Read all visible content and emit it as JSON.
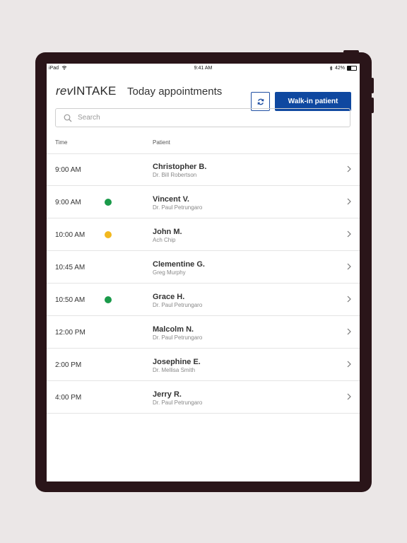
{
  "status_bar": {
    "device": "iPad",
    "time": "9:41 AM",
    "battery": "42%"
  },
  "header": {
    "logo_rev": "rev",
    "logo_intake": "INTAKE",
    "title": "Today appointments",
    "walkin_label": "Walk-in patient"
  },
  "search": {
    "placeholder": "Search"
  },
  "table": {
    "col_time": "Time",
    "col_patient": "Patient",
    "rows": [
      {
        "time": "9:00 AM",
        "name": "Christopher B.",
        "doctor": "Dr. Bill Robertson",
        "status": null
      },
      {
        "time": "9:00 AM",
        "name": "Vincent V.",
        "doctor": "Dr. Paul Petrungaro",
        "status": "green"
      },
      {
        "time": "10:00 AM",
        "name": "John M.",
        "doctor": "Ach Chip",
        "status": "yellow"
      },
      {
        "time": "10:45 AM",
        "name": "Clementine G.",
        "doctor": "Greg Murphy",
        "status": null
      },
      {
        "time": "10:50 AM",
        "name": "Grace H.",
        "doctor": "Dr. Paul Petrungaro",
        "status": "green"
      },
      {
        "time": "12:00 PM",
        "name": "Malcolm N.",
        "doctor": "Dr. Paul Petrungaro",
        "status": null
      },
      {
        "time": "2:00 PM",
        "name": "Josephine E.",
        "doctor": "Dr. Mellisa Smith",
        "status": null
      },
      {
        "time": "4:00 PM",
        "name": "Jerry R.",
        "doctor": "Dr. Paul Petrungaro",
        "status": null
      }
    ]
  },
  "colors": {
    "accent": "#0f48a0",
    "green": "#1a9a4a",
    "yellow": "#f2b81f"
  }
}
